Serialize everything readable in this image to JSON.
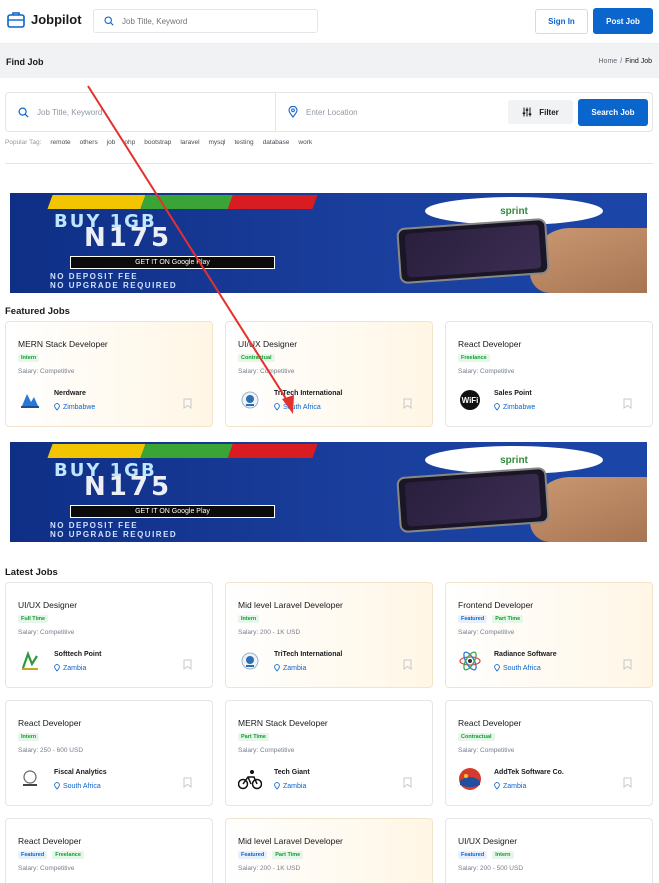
{
  "header": {
    "brand": "Jobpilot",
    "search_placeholder": "Job Title, Keyword",
    "signin_label": "Sign In",
    "post_label": "Post Job"
  },
  "subheader": {
    "title": "Find Job",
    "breadcrumb": [
      "Home",
      "/",
      "Find Job"
    ]
  },
  "search": {
    "keyword_placeholder": "Job Title, Keyword",
    "location_placeholder": "Enter Location",
    "filter_label": "Filter",
    "search_label": "Search Job"
  },
  "popular": {
    "label": "Popular Tag:",
    "tags": [
      "remote",
      "others",
      "job",
      "php",
      "bootstrap",
      "laravel",
      "mysql",
      "testing",
      "database",
      "work"
    ]
  },
  "banner": {
    "buy": "BUY",
    "amount": "1GB",
    "price": "N175",
    "store_label": "GET IT ON Google Play",
    "line1": "NO DEPOSIT FEE",
    "line2": "NO UPGRADE REQUIRED",
    "brand": "sprint"
  },
  "featured": {
    "title": "Featured Jobs",
    "jobs": [
      {
        "title": "MERN Stack Developer",
        "badges": [
          {
            "text": "Intern",
            "color": "green"
          }
        ],
        "salary": "Salary: Competitive",
        "company": "Nerdware",
        "location": "Zimbabwe",
        "logo": "nerdware-logo",
        "warm": true
      },
      {
        "title": "UI/UX Designer",
        "badges": [
          {
            "text": "Contractual",
            "color": "green"
          }
        ],
        "salary": "Salary: Competitive",
        "company": "TriTech International",
        "location": "South Africa",
        "logo": "tritech-logo",
        "warm": true
      },
      {
        "title": "React Developer",
        "badges": [
          {
            "text": "Freelance",
            "color": "green"
          }
        ],
        "salary": "Salary: Competitive",
        "company": "Sales Point",
        "location": "Zimbabwe",
        "logo": "wifi-logo",
        "warm": false
      }
    ]
  },
  "latest": {
    "title": "Latest Jobs",
    "jobs": [
      {
        "title": "UI/UX Designer",
        "badges": [
          {
            "text": "Full Time",
            "color": "green"
          }
        ],
        "salary": "Salary: Competitive",
        "company": "Softtech Point",
        "location": "Zambia",
        "logo": "softtech-logo",
        "warm": false
      },
      {
        "title": "Mid level Laravel Developer",
        "badges": [
          {
            "text": "Intern",
            "color": "green"
          }
        ],
        "salary": "Salary: 200 - 1K USD",
        "company": "TriTech International",
        "location": "Zambia",
        "logo": "tritech-logo",
        "warm": true
      },
      {
        "title": "Frontend Developer",
        "badges": [
          {
            "text": "Featured",
            "color": "blue"
          },
          {
            "text": "Part Time",
            "color": "green"
          }
        ],
        "salary": "Salary: Competitive",
        "company": "Radiance Software",
        "location": "South Africa",
        "logo": "atom-logo",
        "warm": true
      },
      {
        "title": "React Developer",
        "badges": [
          {
            "text": "Intern",
            "color": "green"
          }
        ],
        "salary": "Salary: 250 - 600 USD",
        "company": "Fiscal Analytics",
        "location": "South Africa",
        "logo": "fiscal-logo",
        "warm": false
      },
      {
        "title": "MERN Stack Developer",
        "badges": [
          {
            "text": "Part Time",
            "color": "green"
          }
        ],
        "salary": "Salary: Competitive",
        "company": "Tech Giant",
        "location": "Zambia",
        "logo": "cyclist-logo",
        "warm": false
      },
      {
        "title": "React Developer",
        "badges": [
          {
            "text": "Contractual",
            "color": "green"
          }
        ],
        "salary": "Salary: Competitive",
        "company": "AddTek Software Co.",
        "location": "Zambia",
        "logo": "addtek-logo",
        "warm": false
      },
      {
        "title": "React Developer",
        "badges": [
          {
            "text": "Featured",
            "color": "blue"
          },
          {
            "text": "Freelance",
            "color": "green"
          }
        ],
        "salary": "Salary: Competitive",
        "company": "",
        "location": "",
        "logo": "",
        "warm": false
      },
      {
        "title": "Mid level Laravel Developer",
        "badges": [
          {
            "text": "Featured",
            "color": "blue"
          },
          {
            "text": "Part Time",
            "color": "green"
          }
        ],
        "salary": "Salary: 200 - 1K USD",
        "company": "",
        "location": "",
        "logo": "",
        "warm": true
      },
      {
        "title": "UI/UX Designer",
        "badges": [
          {
            "text": "Featured",
            "color": "blue"
          },
          {
            "text": "Intern",
            "color": "green"
          }
        ],
        "salary": "Salary: 200 - 500 USD",
        "company": "",
        "location": "",
        "logo": "",
        "warm": false
      }
    ]
  },
  "colors": {
    "primary": "#0a65cc",
    "green_badge": "#0ba02c",
    "annotation_arrow": "#e53030"
  }
}
